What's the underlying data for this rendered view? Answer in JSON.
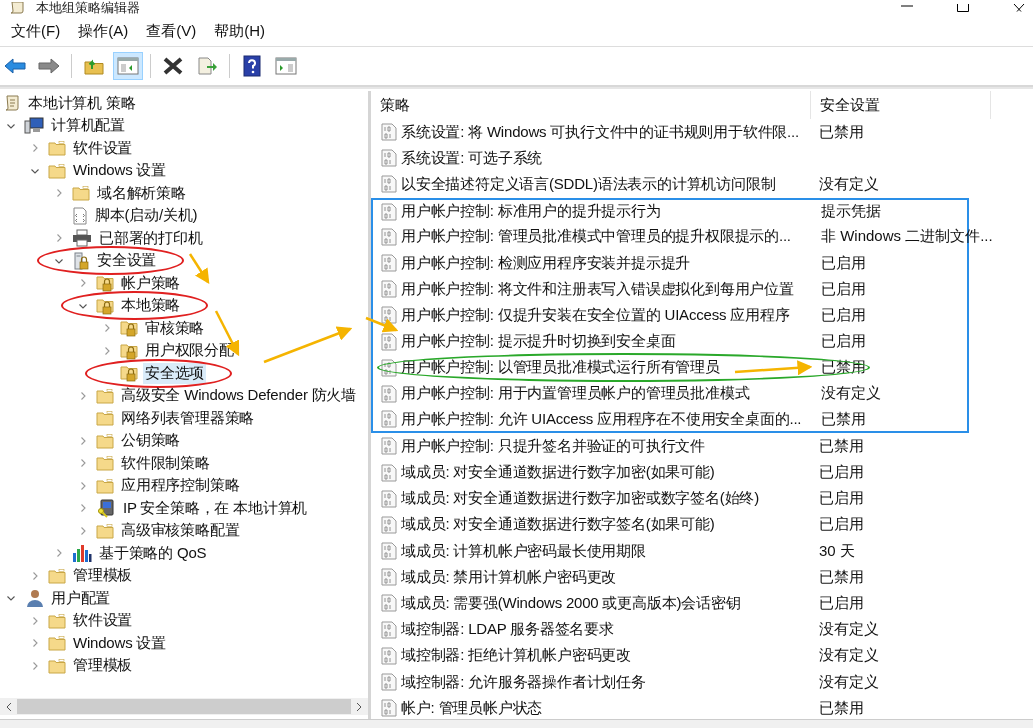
{
  "window": {
    "title": "本地组策略编辑器"
  },
  "menu": [
    "文件(F)",
    "操作(A)",
    "查看(V)",
    "帮助(H)"
  ],
  "toolbar": [
    {
      "kind": "back",
      "pressed": false
    },
    {
      "kind": "forward",
      "pressed": false
    },
    {
      "kind": "separator"
    },
    {
      "kind": "up",
      "pressed": false
    },
    {
      "kind": "tree",
      "pressed": true
    },
    {
      "kind": "separator"
    },
    {
      "kind": "delete",
      "pressed": false
    },
    {
      "kind": "export",
      "pressed": false
    },
    {
      "kind": "separator"
    },
    {
      "kind": "help",
      "pressed": false
    },
    {
      "kind": "pane",
      "pressed": false
    }
  ],
  "tree": {
    "label": "本地计算机 策略",
    "kind": "scroll",
    "selected": false,
    "circled": false,
    "children": [
      {
        "label": "计算机配置",
        "kind": "computer",
        "expanded": true,
        "selected": false,
        "circled": false,
        "children": [
          {
            "label": "软件设置",
            "kind": "folder",
            "expanded": false,
            "selected": false,
            "circled": false
          },
          {
            "label": "Windows 设置",
            "kind": "folder",
            "expanded": true,
            "selected": false,
            "circled": false,
            "children": [
              {
                "label": "域名解析策略",
                "kind": "folder",
                "expanded": false,
                "selected": false,
                "circled": false
              },
              {
                "label": "脚本(启动/关机)",
                "kind": "script",
                "selected": false,
                "circled": false
              },
              {
                "label": "已部署的打印机",
                "kind": "printer",
                "expanded": false,
                "selected": false,
                "circled": false
              },
              {
                "label": "安全设置",
                "kind": "lock-server",
                "expanded": true,
                "selected": false,
                "circled": true,
                "children": [
                  {
                    "label": "帐户策略",
                    "kind": "lock-folder",
                    "expanded": false,
                    "selected": false,
                    "circled": false
                  },
                  {
                    "label": "本地策略",
                    "kind": "lock-folder",
                    "expanded": true,
                    "selected": false,
                    "circled": true,
                    "children": [
                      {
                        "label": "审核策略",
                        "kind": "lock-folder",
                        "expanded": false,
                        "selected": false,
                        "circled": false
                      },
                      {
                        "label": "用户权限分配",
                        "kind": "lock-folder",
                        "expanded": false,
                        "selected": false,
                        "circled": false
                      },
                      {
                        "label": "安全选项",
                        "kind": "lock-folder",
                        "selected": true,
                        "circled": true
                      }
                    ]
                  },
                  {
                    "label": "高级安全 Windows Defender 防火墙",
                    "kind": "folder",
                    "expanded": false,
                    "selected": false,
                    "circled": false
                  },
                  {
                    "label": "网络列表管理器策略",
                    "kind": "folder",
                    "selected": false,
                    "circled": false
                  },
                  {
                    "label": "公钥策略",
                    "kind": "folder",
                    "expanded": false,
                    "selected": false,
                    "circled": false
                  },
                  {
                    "label": "软件限制策略",
                    "kind": "folder",
                    "expanded": false,
                    "selected": false,
                    "circled": false
                  },
                  {
                    "label": "应用程序控制策略",
                    "kind": "folder",
                    "expanded": false,
                    "selected": false,
                    "circled": false
                  },
                  {
                    "label": "IP 安全策略，在 本地计算机",
                    "kind": "ip",
                    "expanded": false,
                    "selected": false,
                    "circled": false
                  },
                  {
                    "label": "高级审核策略配置",
                    "kind": "folder",
                    "expanded": false,
                    "selected": false,
                    "circled": false
                  }
                ]
              },
              {
                "label": "基于策略的 QoS",
                "kind": "chart",
                "expanded": false,
                "selected": false,
                "circled": false
              }
            ]
          },
          {
            "label": "管理模板",
            "kind": "folder",
            "expanded": false,
            "selected": false,
            "circled": false
          }
        ]
      },
      {
        "label": "用户配置",
        "kind": "user",
        "expanded": true,
        "selected": false,
        "circled": false,
        "children": [
          {
            "label": "软件设置",
            "kind": "folder",
            "expanded": false,
            "selected": false,
            "circled": false
          },
          {
            "label": "Windows 设置",
            "kind": "folder",
            "expanded": false,
            "selected": false,
            "circled": false
          },
          {
            "label": "管理模板",
            "kind": "folder",
            "expanded": false,
            "selected": false,
            "circled": false
          }
        ]
      }
    ]
  },
  "table": {
    "columns": [
      "策略",
      "安全设置"
    ],
    "rows": [
      {
        "policy": "系统设置: 将 Windows 可执行文件中的证书规则用于软件限...",
        "setting": "已禁用",
        "circled": false,
        "boxed": false
      },
      {
        "policy": "系统设置: 可选子系统",
        "circled": false,
        "boxed": false
      },
      {
        "policy": "以安全描述符定义语言(SDDL)语法表示的计算机访问限制",
        "setting": "没有定义",
        "circled": false,
        "boxed": false
      },
      {
        "policy": "用户帐户控制: 标准用户的提升提示行为",
        "setting": "提示凭据",
        "circled": false,
        "boxed": true
      },
      {
        "policy": "用户帐户控制: 管理员批准模式中管理员的提升权限提示的...",
        "setting": "非 Windows 二进制文件...",
        "circled": false,
        "boxed": true
      },
      {
        "policy": "用户帐户控制: 检测应用程序安装并提示提升",
        "setting": "已启用",
        "circled": false,
        "boxed": true
      },
      {
        "policy": "用户帐户控制: 将文件和注册表写入错误虚拟化到每用户位置",
        "setting": "已启用",
        "circled": false,
        "boxed": true
      },
      {
        "policy": "用户帐户控制: 仅提升安装在安全位置的 UIAccess 应用程序",
        "setting": "已启用",
        "circled": false,
        "boxed": true
      },
      {
        "policy": "用户帐户控制: 提示提升时切换到安全桌面",
        "setting": "已启用",
        "circled": false,
        "boxed": true
      },
      {
        "policy": "用户帐户控制: 以管理员批准模式运行所有管理员",
        "setting": "已禁用",
        "circled": true,
        "boxed": true
      },
      {
        "policy": "用户帐户控制: 用于内置管理员帐户的管理员批准模式",
        "setting": "没有定义",
        "circled": false,
        "boxed": true
      },
      {
        "policy": "用户帐户控制: 允许 UIAccess 应用程序在不使用安全桌面的...",
        "setting": "已禁用",
        "circled": false,
        "boxed": true
      },
      {
        "policy": "用户帐户控制: 只提升签名并验证的可执行文件",
        "setting": "已禁用",
        "circled": false,
        "boxed": false
      },
      {
        "policy": "域成员: 对安全通道数据进行数字加密(如果可能)",
        "setting": "已启用",
        "circled": false,
        "boxed": false
      },
      {
        "policy": "域成员: 对安全通道数据进行数字加密或数字签名(始终)",
        "setting": "已启用",
        "circled": false,
        "boxed": false
      },
      {
        "policy": "域成员: 对安全通道数据进行数字签名(如果可能)",
        "setting": "已启用",
        "circled": false,
        "boxed": false
      },
      {
        "policy": "域成员: 计算机帐户密码最长使用期限",
        "setting": "30 天",
        "circled": false,
        "boxed": false
      },
      {
        "policy": "域成员: 禁用计算机帐户密码更改",
        "setting": "已禁用",
        "circled": false,
        "boxed": false
      },
      {
        "policy": "域成员: 需要强(Windows 2000 或更高版本)会话密钥",
        "setting": "已启用",
        "circled": false,
        "boxed": false
      },
      {
        "policy": "域控制器: LDAP 服务器签名要求",
        "setting": "没有定义",
        "circled": false,
        "boxed": false
      },
      {
        "policy": "域控制器: 拒绝计算机帐户密码更改",
        "setting": "没有定义",
        "circled": false,
        "boxed": false
      },
      {
        "policy": "域控制器: 允许服务器操作者计划任务",
        "setting": "没有定义",
        "circled": false,
        "boxed": false
      },
      {
        "policy": "帐户: 管理员帐户状态",
        "setting": "已禁用",
        "circled": false,
        "boxed": false
      }
    ]
  }
}
